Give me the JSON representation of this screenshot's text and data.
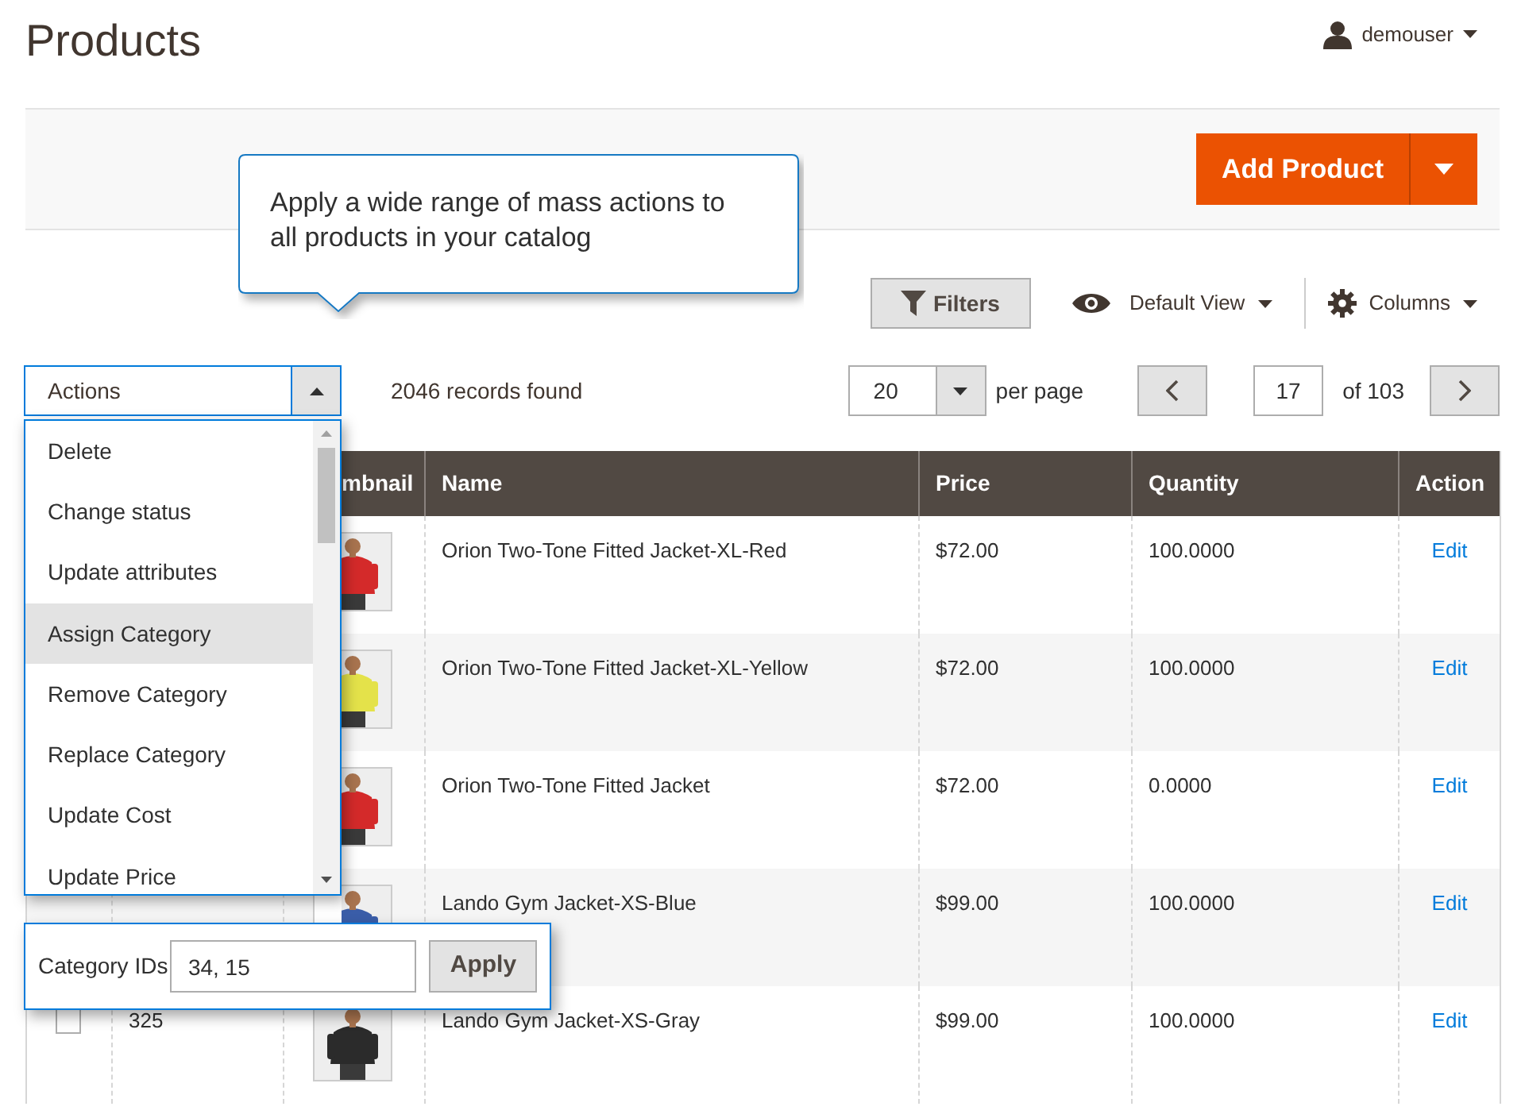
{
  "page_title": "Products",
  "user": {
    "name": "demouser"
  },
  "add_product": {
    "label": "Add Product"
  },
  "tooltip": "Apply a wide range of mass actions to all products in your catalog",
  "toolbar": {
    "filters": "Filters",
    "view": "Default View",
    "columns": "Columns"
  },
  "actions": {
    "label": "Actions",
    "expanded": true,
    "items": [
      {
        "label": "Delete",
        "selected": false
      },
      {
        "label": "Change status",
        "selected": false
      },
      {
        "label": "Update attributes",
        "selected": false
      },
      {
        "label": "Assign Category",
        "selected": true
      },
      {
        "label": "Remove Category",
        "selected": false
      },
      {
        "label": "Replace Category",
        "selected": false
      },
      {
        "label": "Update Cost",
        "selected": false
      },
      {
        "label": "Update Price",
        "selected": false
      }
    ]
  },
  "records": "2046 records found",
  "per_page": {
    "value": "20",
    "label": "per page"
  },
  "pager": {
    "page": "17",
    "total": "of 103"
  },
  "mass_action_form": {
    "label": "Category IDs",
    "value": "34, 15",
    "button": "Apply"
  },
  "table": {
    "columns": [
      "mbnail",
      "Name",
      "Price",
      "Quantity",
      "Action"
    ],
    "rows": [
      {
        "name": "Orion Two-Tone Fitted Jacket-XL-Red",
        "price": "$72.00",
        "quantity": "100.0000",
        "action": "Edit"
      },
      {
        "name": "Orion Two-Tone Fitted Jacket-XL-Yellow",
        "price": "$72.00",
        "quantity": "100.0000",
        "action": "Edit"
      },
      {
        "name": "Orion Two-Tone Fitted Jacket",
        "price": "$72.00",
        "quantity": "0.0000",
        "action": "Edit"
      },
      {
        "name": "Lando Gym Jacket-XS-Blue",
        "price": "$99.00",
        "quantity": "100.0000",
        "action": "Edit"
      },
      {
        "id": "325",
        "checked": false,
        "name": "Lando Gym Jacket-XS-Gray",
        "price": "$99.00",
        "quantity": "100.0000",
        "action": "Edit"
      }
    ]
  }
}
